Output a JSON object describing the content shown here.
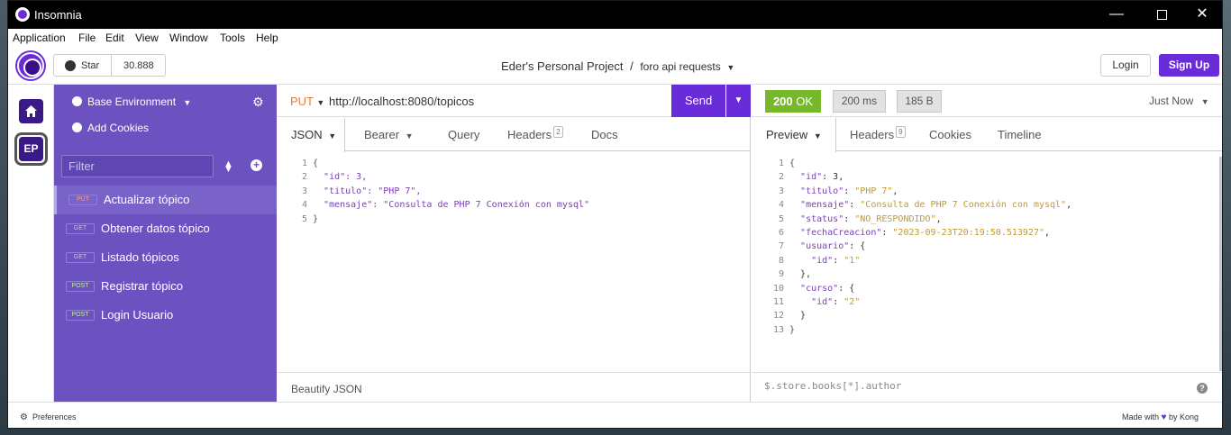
{
  "window": {
    "title": "Insomnia"
  },
  "menu": [
    "Application",
    "File",
    "Edit",
    "View",
    "Window",
    "Tools",
    "Help"
  ],
  "header": {
    "star_label": "Star",
    "star_count": "30.888",
    "project": "Eder's Personal Project",
    "separator": "/",
    "collection": "foro api requests",
    "login_label": "Login",
    "signup_label": "Sign Up"
  },
  "rail": {
    "home_icon": "home-icon",
    "workspace_initials": "EP"
  },
  "sidebar": {
    "environment": "Base Environment",
    "add_cookies": "Add Cookies",
    "filter_placeholder": "Filter",
    "requests": [
      {
        "method": "PUT",
        "name": "Actualizar tópico",
        "active": true
      },
      {
        "method": "GET",
        "name": "Obtener datos tópico"
      },
      {
        "method": "GET",
        "name": "Listado tópicos"
      },
      {
        "method": "POST",
        "name": "Registrar tópico"
      },
      {
        "method": "POST",
        "name": "Login Usuario"
      }
    ]
  },
  "request": {
    "method": "PUT",
    "url": "http://localhost:8080/topicos",
    "send_label": "Send",
    "tabs": {
      "body": "JSON",
      "auth": "Bearer",
      "query": "Query",
      "headers": "Headers",
      "headers_count": "2",
      "docs": "Docs"
    },
    "body_lines": [
      [
        "1",
        "{"
      ],
      [
        "2",
        "\"id\": 3,"
      ],
      [
        "3",
        "\"titulo\": \"PHP 7\","
      ],
      [
        "4",
        "\"mensaje\": \"Consulta de PHP 7 Conexión con mysql\""
      ],
      [
        "5",
        "}"
      ]
    ],
    "beautify_label": "Beautify JSON"
  },
  "response": {
    "status_code": "200",
    "status_text": "OK",
    "time": "200 ms",
    "size": "185 B",
    "timestamp": "Just Now",
    "tabs": {
      "preview": "Preview",
      "headers": "Headers",
      "headers_count": "9",
      "cookies": "Cookies",
      "timeline": "Timeline"
    },
    "query_placeholder": "$.store.books[*].author"
  },
  "statusbar": {
    "preferences": "Preferences",
    "made_with": "Made with",
    "by": "by Kong"
  },
  "colors": {
    "accent": "#6a2bd8",
    "sidebar": "#6b52c0",
    "success": "#76b82a"
  }
}
